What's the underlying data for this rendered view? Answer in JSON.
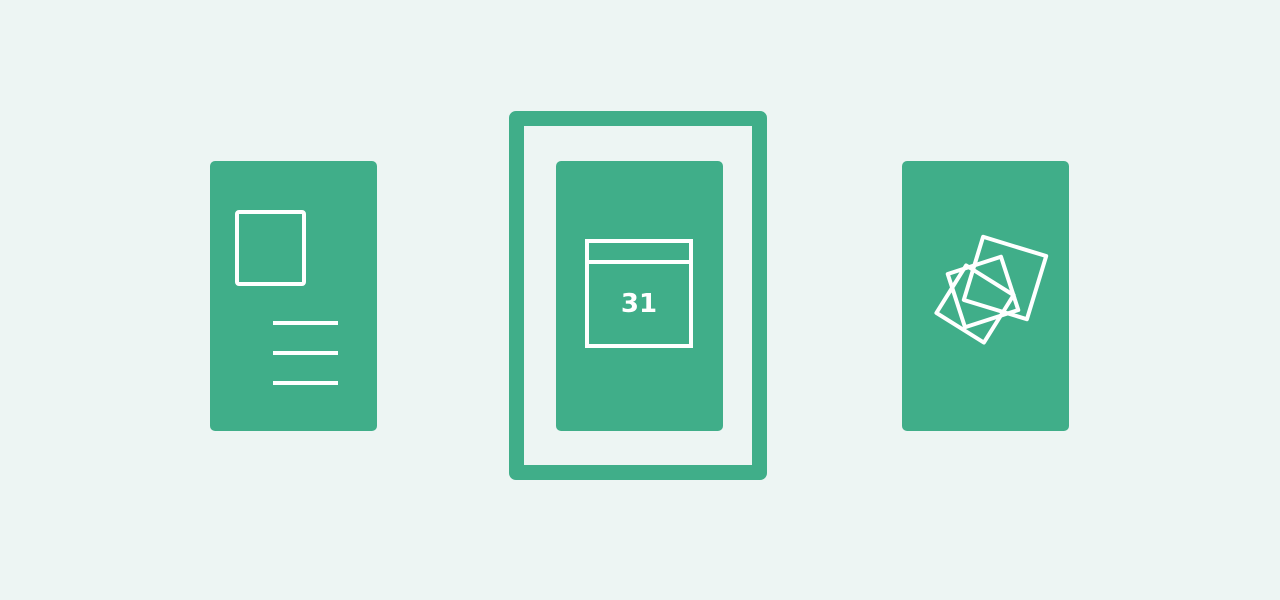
{
  "layouts": [
    {
      "id": "document",
      "icon": "document-layout-icon",
      "selected": false
    },
    {
      "id": "calendar",
      "icon": "calendar-icon",
      "selected": true,
      "calendar_day": "31"
    },
    {
      "id": "gallery",
      "icon": "photo-stack-icon",
      "selected": false
    }
  ],
  "colors": {
    "background": "#EDF5F3",
    "accent": "#40AE89",
    "icon_stroke": "#FFFFFF"
  }
}
